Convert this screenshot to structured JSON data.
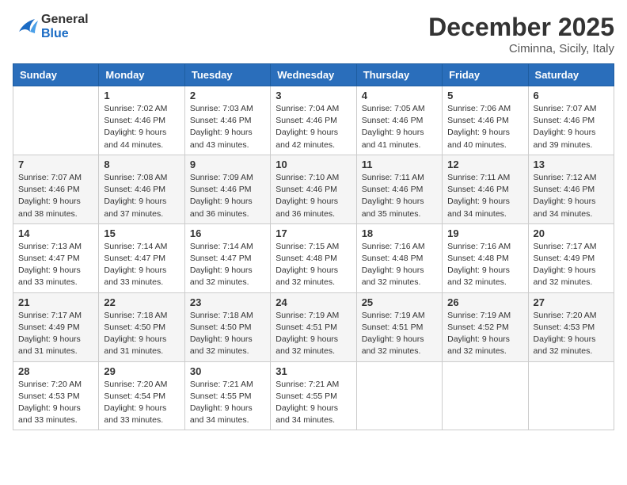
{
  "header": {
    "logo": {
      "text_general": "General",
      "text_blue": "Blue"
    },
    "month": "December 2025",
    "location": "Ciminna, Sicily, Italy"
  },
  "weekdays": [
    "Sunday",
    "Monday",
    "Tuesday",
    "Wednesday",
    "Thursday",
    "Friday",
    "Saturday"
  ],
  "weeks": [
    [
      {
        "day": "",
        "sunrise": "",
        "sunset": "",
        "daylight": ""
      },
      {
        "day": "1",
        "sunrise": "Sunrise: 7:02 AM",
        "sunset": "Sunset: 4:46 PM",
        "daylight": "Daylight: 9 hours and 44 minutes."
      },
      {
        "day": "2",
        "sunrise": "Sunrise: 7:03 AM",
        "sunset": "Sunset: 4:46 PM",
        "daylight": "Daylight: 9 hours and 43 minutes."
      },
      {
        "day": "3",
        "sunrise": "Sunrise: 7:04 AM",
        "sunset": "Sunset: 4:46 PM",
        "daylight": "Daylight: 9 hours and 42 minutes."
      },
      {
        "day": "4",
        "sunrise": "Sunrise: 7:05 AM",
        "sunset": "Sunset: 4:46 PM",
        "daylight": "Daylight: 9 hours and 41 minutes."
      },
      {
        "day": "5",
        "sunrise": "Sunrise: 7:06 AM",
        "sunset": "Sunset: 4:46 PM",
        "daylight": "Daylight: 9 hours and 40 minutes."
      },
      {
        "day": "6",
        "sunrise": "Sunrise: 7:07 AM",
        "sunset": "Sunset: 4:46 PM",
        "daylight": "Daylight: 9 hours and 39 minutes."
      }
    ],
    [
      {
        "day": "7",
        "sunrise": "Sunrise: 7:07 AM",
        "sunset": "Sunset: 4:46 PM",
        "daylight": "Daylight: 9 hours and 38 minutes."
      },
      {
        "day": "8",
        "sunrise": "Sunrise: 7:08 AM",
        "sunset": "Sunset: 4:46 PM",
        "daylight": "Daylight: 9 hours and 37 minutes."
      },
      {
        "day": "9",
        "sunrise": "Sunrise: 7:09 AM",
        "sunset": "Sunset: 4:46 PM",
        "daylight": "Daylight: 9 hours and 36 minutes."
      },
      {
        "day": "10",
        "sunrise": "Sunrise: 7:10 AM",
        "sunset": "Sunset: 4:46 PM",
        "daylight": "Daylight: 9 hours and 36 minutes."
      },
      {
        "day": "11",
        "sunrise": "Sunrise: 7:11 AM",
        "sunset": "Sunset: 4:46 PM",
        "daylight": "Daylight: 9 hours and 35 minutes."
      },
      {
        "day": "12",
        "sunrise": "Sunrise: 7:11 AM",
        "sunset": "Sunset: 4:46 PM",
        "daylight": "Daylight: 9 hours and 34 minutes."
      },
      {
        "day": "13",
        "sunrise": "Sunrise: 7:12 AM",
        "sunset": "Sunset: 4:46 PM",
        "daylight": "Daylight: 9 hours and 34 minutes."
      }
    ],
    [
      {
        "day": "14",
        "sunrise": "Sunrise: 7:13 AM",
        "sunset": "Sunset: 4:47 PM",
        "daylight": "Daylight: 9 hours and 33 minutes."
      },
      {
        "day": "15",
        "sunrise": "Sunrise: 7:14 AM",
        "sunset": "Sunset: 4:47 PM",
        "daylight": "Daylight: 9 hours and 33 minutes."
      },
      {
        "day": "16",
        "sunrise": "Sunrise: 7:14 AM",
        "sunset": "Sunset: 4:47 PM",
        "daylight": "Daylight: 9 hours and 32 minutes."
      },
      {
        "day": "17",
        "sunrise": "Sunrise: 7:15 AM",
        "sunset": "Sunset: 4:48 PM",
        "daylight": "Daylight: 9 hours and 32 minutes."
      },
      {
        "day": "18",
        "sunrise": "Sunrise: 7:16 AM",
        "sunset": "Sunset: 4:48 PM",
        "daylight": "Daylight: 9 hours and 32 minutes."
      },
      {
        "day": "19",
        "sunrise": "Sunrise: 7:16 AM",
        "sunset": "Sunset: 4:48 PM",
        "daylight": "Daylight: 9 hours and 32 minutes."
      },
      {
        "day": "20",
        "sunrise": "Sunrise: 7:17 AM",
        "sunset": "Sunset: 4:49 PM",
        "daylight": "Daylight: 9 hours and 32 minutes."
      }
    ],
    [
      {
        "day": "21",
        "sunrise": "Sunrise: 7:17 AM",
        "sunset": "Sunset: 4:49 PM",
        "daylight": "Daylight: 9 hours and 31 minutes."
      },
      {
        "day": "22",
        "sunrise": "Sunrise: 7:18 AM",
        "sunset": "Sunset: 4:50 PM",
        "daylight": "Daylight: 9 hours and 31 minutes."
      },
      {
        "day": "23",
        "sunrise": "Sunrise: 7:18 AM",
        "sunset": "Sunset: 4:50 PM",
        "daylight": "Daylight: 9 hours and 32 minutes."
      },
      {
        "day": "24",
        "sunrise": "Sunrise: 7:19 AM",
        "sunset": "Sunset: 4:51 PM",
        "daylight": "Daylight: 9 hours and 32 minutes."
      },
      {
        "day": "25",
        "sunrise": "Sunrise: 7:19 AM",
        "sunset": "Sunset: 4:51 PM",
        "daylight": "Daylight: 9 hours and 32 minutes."
      },
      {
        "day": "26",
        "sunrise": "Sunrise: 7:19 AM",
        "sunset": "Sunset: 4:52 PM",
        "daylight": "Daylight: 9 hours and 32 minutes."
      },
      {
        "day": "27",
        "sunrise": "Sunrise: 7:20 AM",
        "sunset": "Sunset: 4:53 PM",
        "daylight": "Daylight: 9 hours and 32 minutes."
      }
    ],
    [
      {
        "day": "28",
        "sunrise": "Sunrise: 7:20 AM",
        "sunset": "Sunset: 4:53 PM",
        "daylight": "Daylight: 9 hours and 33 minutes."
      },
      {
        "day": "29",
        "sunrise": "Sunrise: 7:20 AM",
        "sunset": "Sunset: 4:54 PM",
        "daylight": "Daylight: 9 hours and 33 minutes."
      },
      {
        "day": "30",
        "sunrise": "Sunrise: 7:21 AM",
        "sunset": "Sunset: 4:55 PM",
        "daylight": "Daylight: 9 hours and 34 minutes."
      },
      {
        "day": "31",
        "sunrise": "Sunrise: 7:21 AM",
        "sunset": "Sunset: 4:55 PM",
        "daylight": "Daylight: 9 hours and 34 minutes."
      },
      {
        "day": "",
        "sunrise": "",
        "sunset": "",
        "daylight": ""
      },
      {
        "day": "",
        "sunrise": "",
        "sunset": "",
        "daylight": ""
      },
      {
        "day": "",
        "sunrise": "",
        "sunset": "",
        "daylight": ""
      }
    ]
  ]
}
